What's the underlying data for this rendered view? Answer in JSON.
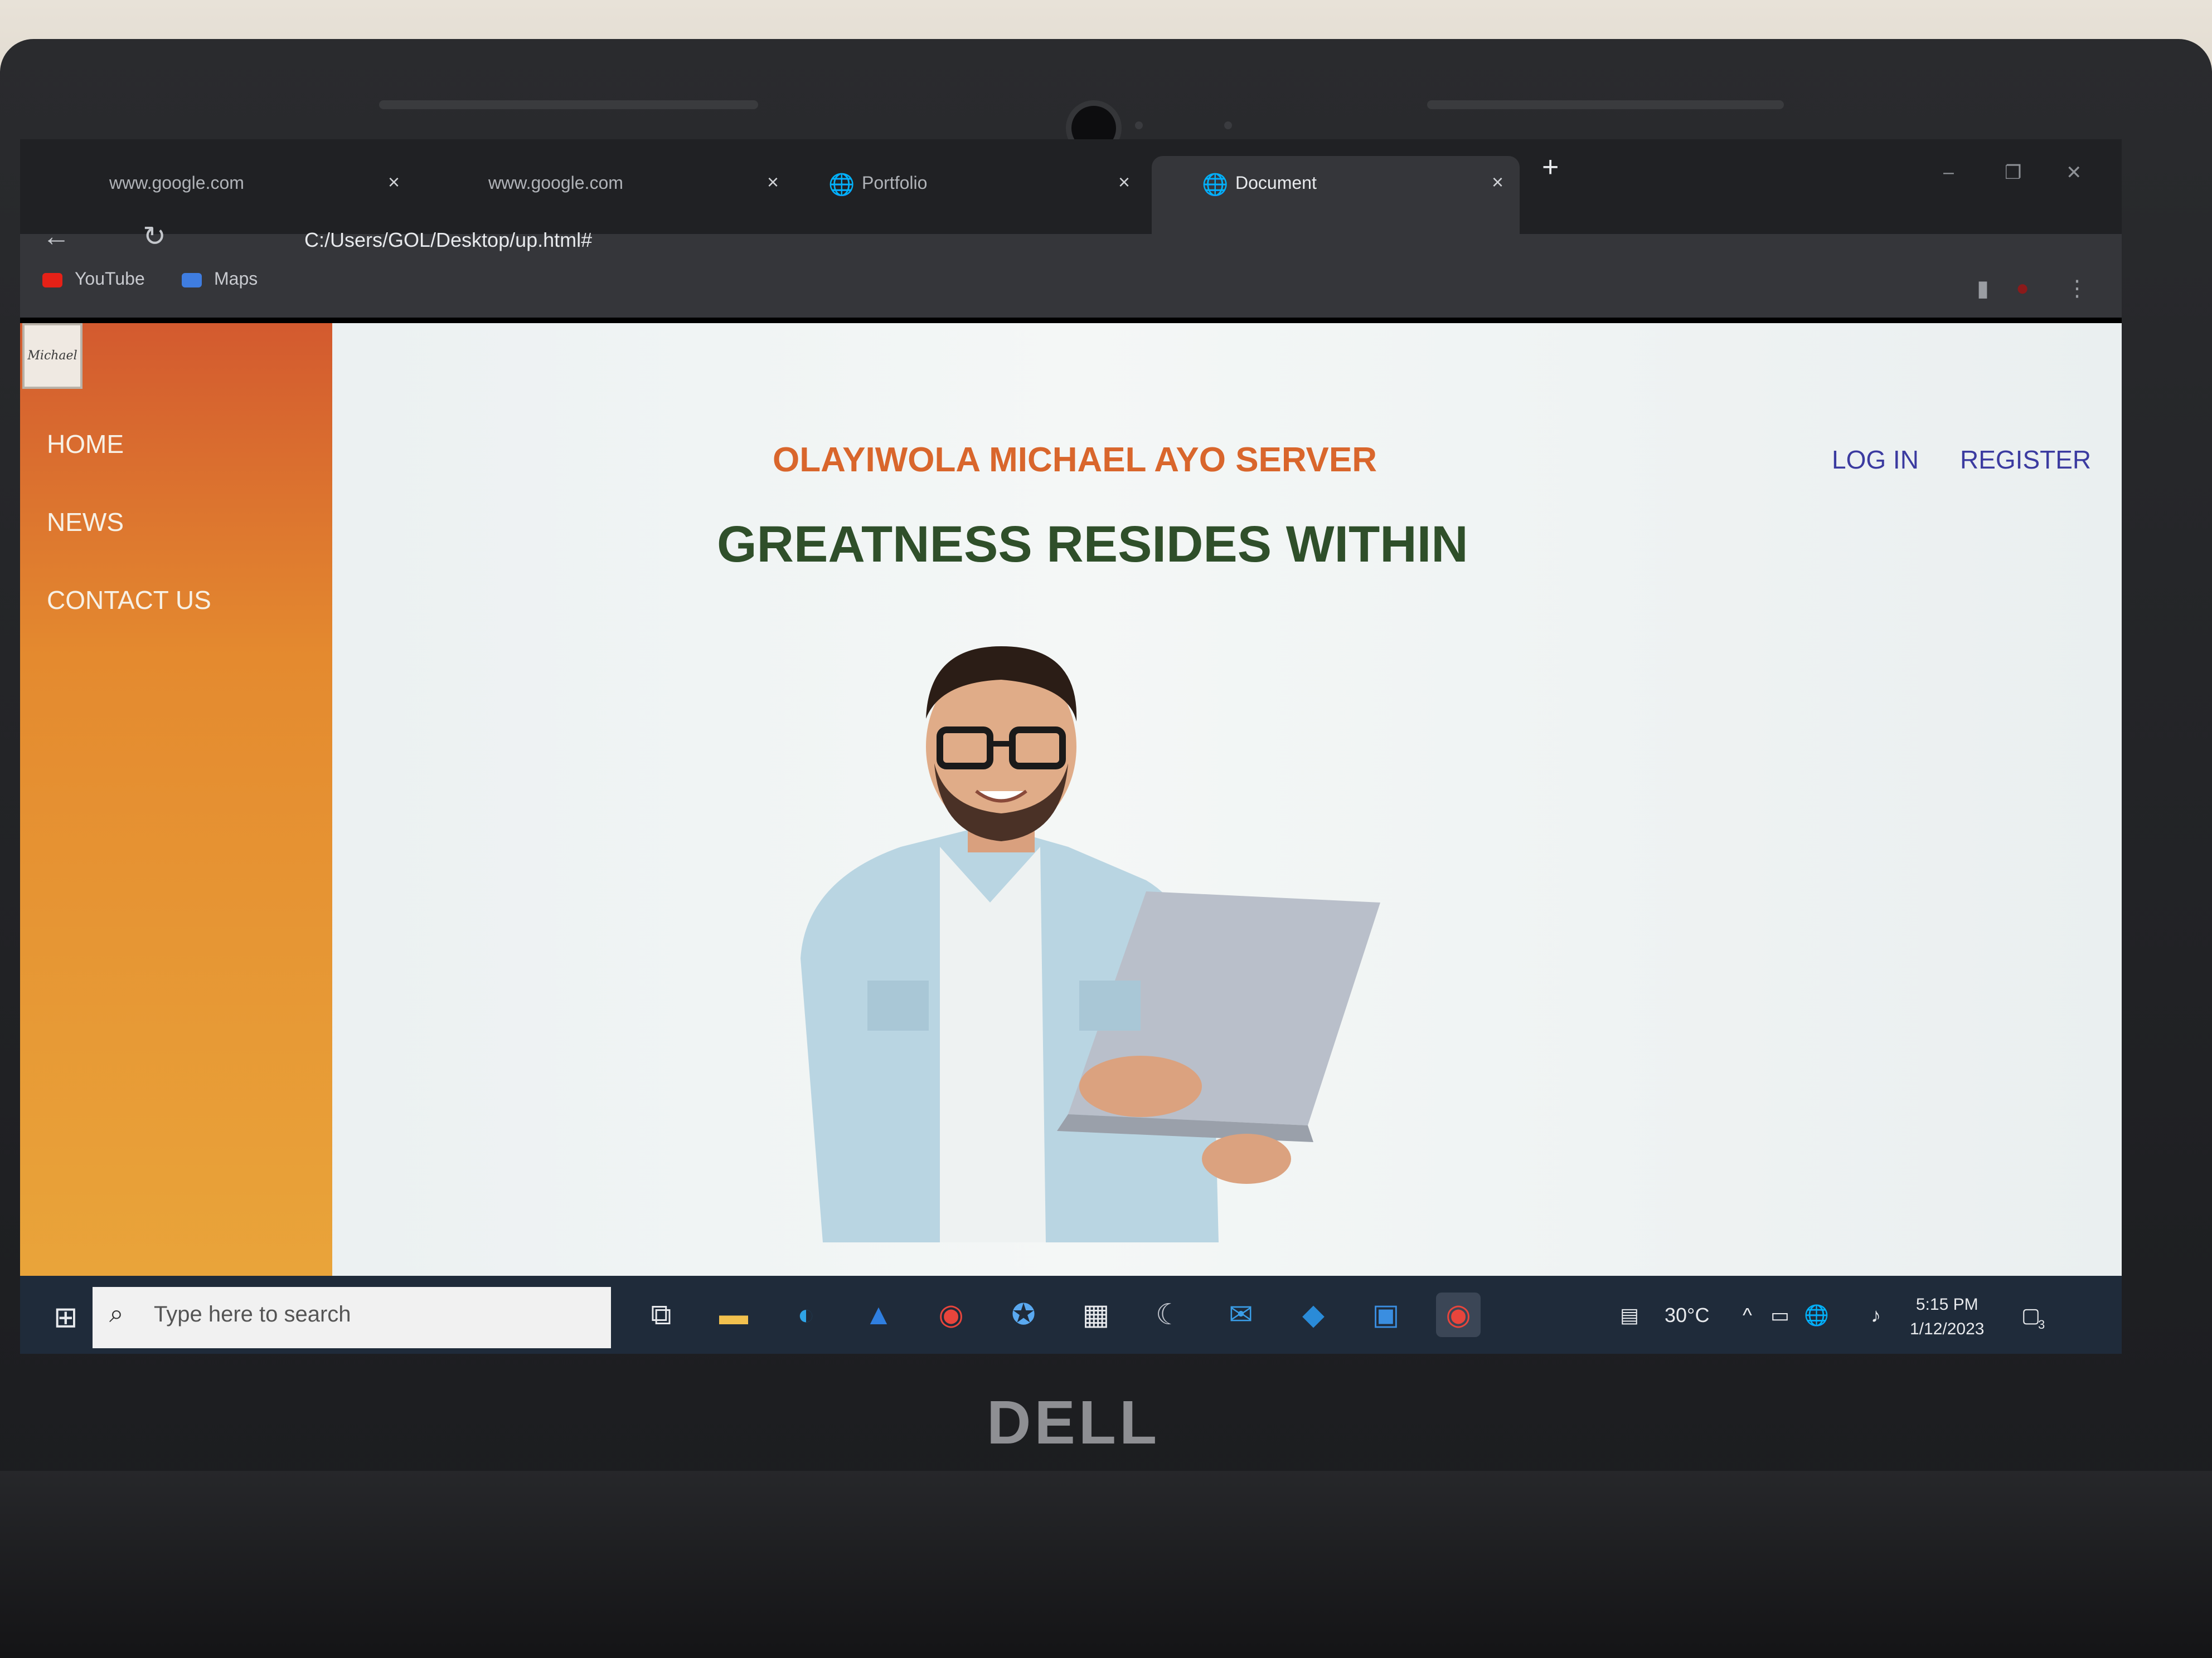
{
  "tabs": [
    {
      "title": "www.google.com",
      "close": "×"
    },
    {
      "title": "www.google.com",
      "close": "×"
    },
    {
      "title": "Portfolio",
      "close": "×"
    },
    {
      "title": "Document",
      "close": "×"
    }
  ],
  "new_tab": "+",
  "window_controls": {
    "minimize": "–",
    "restore": "❐",
    "close": "✕"
  },
  "toolbar": {
    "back": "←",
    "reload": "↻",
    "url": "C:/Users/GOL/Desktop/up.html#",
    "menu": "⋮"
  },
  "bookmarks": [
    {
      "label": "YouTube",
      "icon": "youtube-icon",
      "color": "#e62117"
    },
    {
      "label": "Maps",
      "icon": "maps-icon",
      "color": "#3f7de0"
    }
  ],
  "sidebar": {
    "logo": "Michael",
    "items": [
      "HOME",
      "NEWS",
      "CONTACT US"
    ]
  },
  "header": {
    "site_title": "OLAYIWOLA MICHAEL AYO SERVER",
    "headline": "GREATNESS RESIDES WITHIN",
    "login": "LOG IN",
    "register": "REGISTER"
  },
  "taskbar": {
    "search_placeholder": "Type here to search",
    "temperature": "30°C",
    "time": "5:15 PM",
    "date": "1/12/2023",
    "notifications": "3"
  },
  "colors": {
    "sidebar_top": "#d35a2f",
    "sidebar_bottom": "#e9a43a",
    "site_title": "#d9662c",
    "headline": "#2f4f2a",
    "auth_links": "#3b3ba0"
  },
  "laptop_brand": "DELL"
}
